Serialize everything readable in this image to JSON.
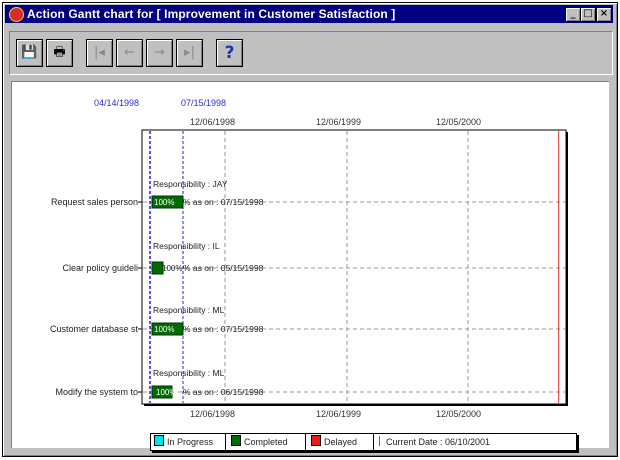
{
  "window": {
    "title": "Action Gantt chart for [ Improvement in Customer Satisfaction ]",
    "controls": {
      "minimize": "_",
      "maximize": "□",
      "close": "×"
    }
  },
  "toolbar": {
    "buttons": [
      {
        "icon": "save-icon",
        "glyph": "💾",
        "enabled": true
      },
      {
        "icon": "print-icon",
        "glyph": "🖶",
        "enabled": true
      },
      {
        "icon": "first-page-icon",
        "glyph": "|◂",
        "enabled": false
      },
      {
        "icon": "previous-page-icon",
        "glyph": "←",
        "enabled": false
      },
      {
        "icon": "next-page-icon",
        "glyph": "→",
        "enabled": false
      },
      {
        "icon": "last-page-icon",
        "glyph": "▸|",
        "enabled": false
      },
      {
        "icon": "help-icon",
        "glyph": "?",
        "enabled": true
      }
    ]
  },
  "chart_data": {
    "type": "gantt",
    "marker_dates": [
      "04/14/1998",
      "07/15/1998"
    ],
    "axis_ticks": [
      "12/06/1998",
      "12/06/1999",
      "12/05/2000"
    ],
    "tasks": [
      {
        "name": "Request sales person",
        "responsibility": "Responsibility : JAY",
        "percent": "100%",
        "status_text": "% as on : 07/15/1998"
      },
      {
        "name": "Clear policy guideli",
        "responsibility": "Responsibility : IL",
        "percent": "100%",
        "status_text": "% as on : 05/15/1998"
      },
      {
        "name": "Customer database st",
        "responsibility": "Responsibility : ML",
        "percent": "100%",
        "status_text": "% as on : 07/15/1998"
      },
      {
        "name": "Modify the system to",
        "responsibility": "Responsibility : ML",
        "percent": "100%",
        "status_text": "% as on : 06/15/1998"
      }
    ],
    "bar_fractions": [
      0.28,
      0.1,
      0.28,
      0.18
    ],
    "current_date_fraction": 0.985,
    "colors": {
      "in_progress": "#00e5e5",
      "completed": "#006b00",
      "delayed": "#e51d1d",
      "marker_line": "#2020e0",
      "current_date_line": "#e03030"
    }
  },
  "legend": {
    "in_progress": "In Progress",
    "completed": "Completed",
    "delayed": "Delayed",
    "current_date": "Current Date : 06/10/2001"
  }
}
